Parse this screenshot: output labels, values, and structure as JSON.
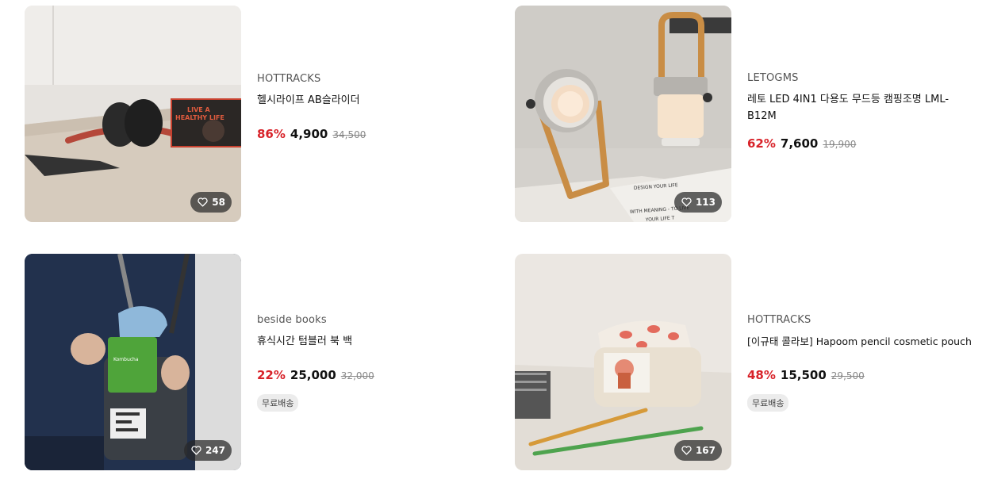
{
  "products": [
    {
      "brand": "HOTTRACKS",
      "title": "헬시라이프 AB슬라이더",
      "discount": "86%",
      "price": "4,900",
      "original_price": "34,500",
      "likes": "58",
      "tag": ""
    },
    {
      "brand": "LETOGMS",
      "title": "레토 LED 4IN1 다용도 무드등 캠핑조명 LML-B12M",
      "discount": "62%",
      "price": "7,600",
      "original_price": "19,900",
      "likes": "113",
      "tag": ""
    },
    {
      "brand": "beside books",
      "title": "휴식시간 텀블러 북 백",
      "discount": "22%",
      "price": "25,000",
      "original_price": "32,000",
      "likes": "247",
      "tag": "무료배송"
    },
    {
      "brand": "HOTTRACKS",
      "title": "[이규태 콜라보] Hapoom pencil cosmetic pouch",
      "discount": "48%",
      "price": "15,500",
      "original_price": "29,500",
      "likes": "167",
      "tag": "무료배송"
    }
  ],
  "image_lettering": {
    "product_1_box": "LIVE A HEALTHY LIFE",
    "product_2_paper": "DESIGN YOUR LIFE WITH MEANING TO LIVE YOUR LIFE T",
    "product_3_pouch": "Kombucha"
  },
  "colors": {
    "discount": "#d8232a",
    "badge_bg": "#ececec",
    "like_bg": "rgba(40,40,40,0.72)"
  }
}
